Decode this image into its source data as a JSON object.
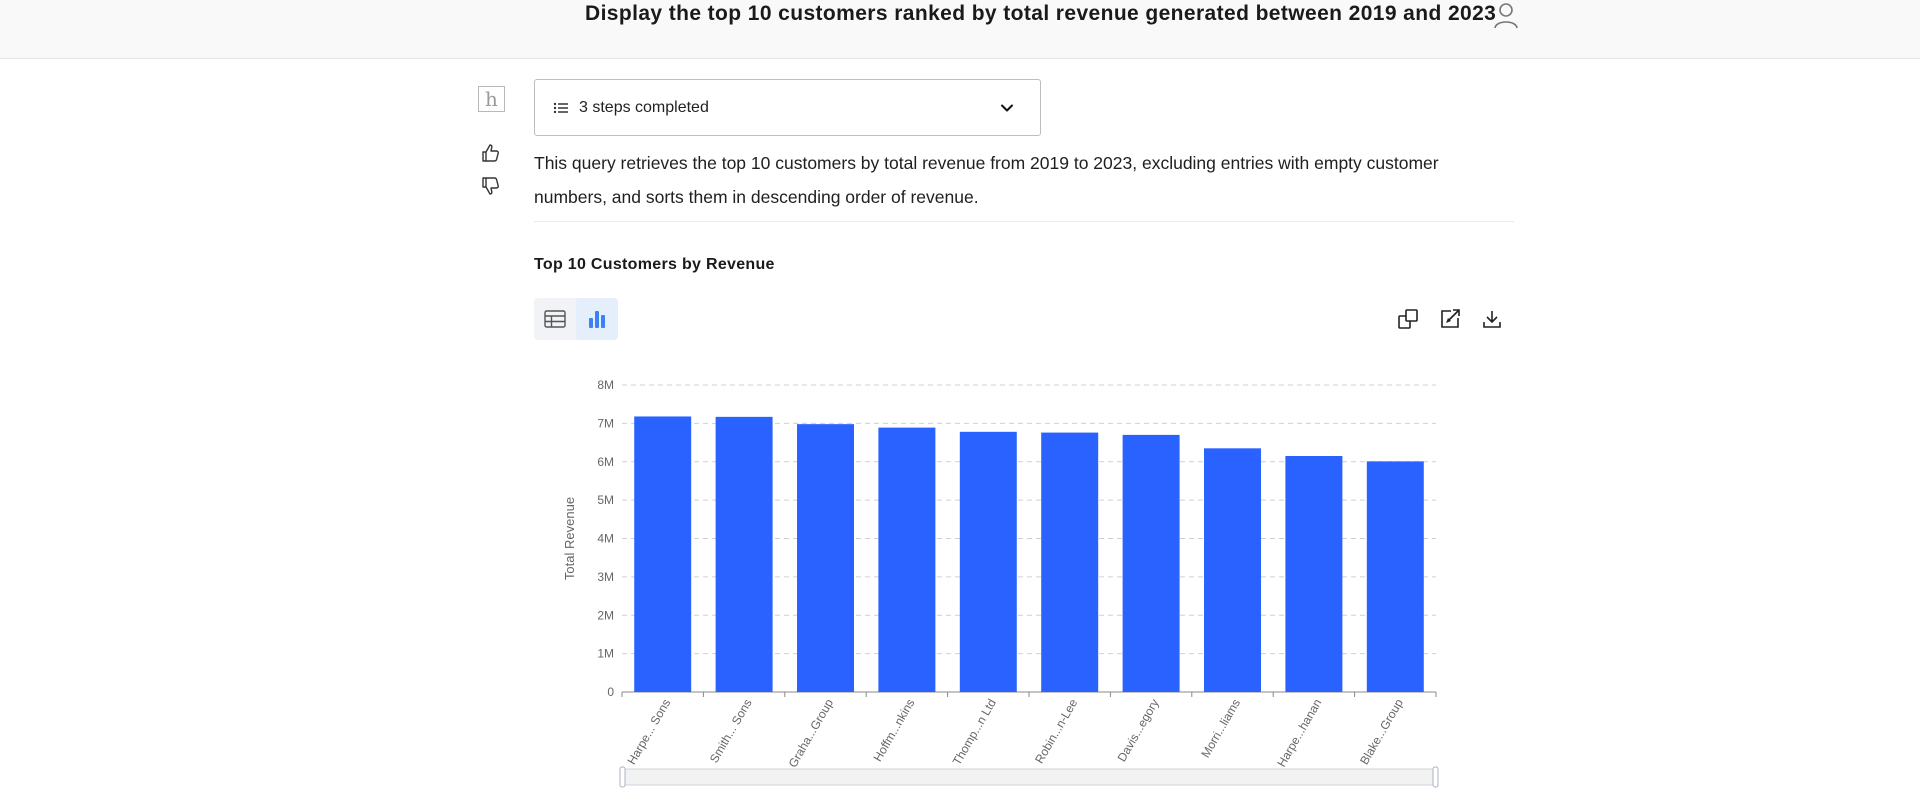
{
  "header": {
    "title": "Display the top 10 customers ranked by total revenue generated between 2019 and 2023",
    "avatar_icon": "user-icon"
  },
  "assistant": {
    "avatar_letter": "h",
    "feedback": {
      "up_icon": "thumbs-up-icon",
      "down_icon": "thumbs-down-icon"
    },
    "steps": {
      "label": "3 steps completed",
      "icon": "list-icon",
      "toggle_icon": "chevron-down-icon"
    },
    "description": "This query retrieves the top 10 customers by total revenue from 2019 to 2023, excluding entries with empty customer numbers, and sorts them in descending order of revenue."
  },
  "result": {
    "title": "Top 10 Customers by Revenue",
    "view_toggle": {
      "table_icon": "table-icon",
      "chart_icon": "bar-chart-icon",
      "active": "chart"
    },
    "toolbar": {
      "copy_icon": "copy-icon",
      "open_icon": "open-in-editor-icon",
      "download_icon": "download-icon"
    }
  },
  "colors": {
    "bar": "#2962ff",
    "accent": "#3b82f6",
    "grid": "#d0d0d0"
  },
  "chart_data": {
    "type": "bar",
    "categories": [
      "Harpe... Sons",
      "Smith... Sons",
      "Graha...Group",
      "Hoffm...nkins",
      "Thomp...n Ltd",
      "Robin...n-Lee",
      "Davis...egory",
      "Morri...liams",
      "Harpe...hanan",
      "Blake...Group"
    ],
    "values": [
      7180000,
      7170000,
      6980000,
      6890000,
      6780000,
      6760000,
      6700000,
      6350000,
      6150000,
      6010000
    ],
    "ylabel": "Total Revenue",
    "xlabel": "",
    "ylim": [
      0,
      8000000
    ],
    "yticks": [
      "0",
      "1M",
      "2M",
      "3M",
      "4M",
      "5M",
      "6M",
      "7M",
      "8M"
    ],
    "grid": true,
    "legend": "none",
    "zoom_slider": true
  }
}
